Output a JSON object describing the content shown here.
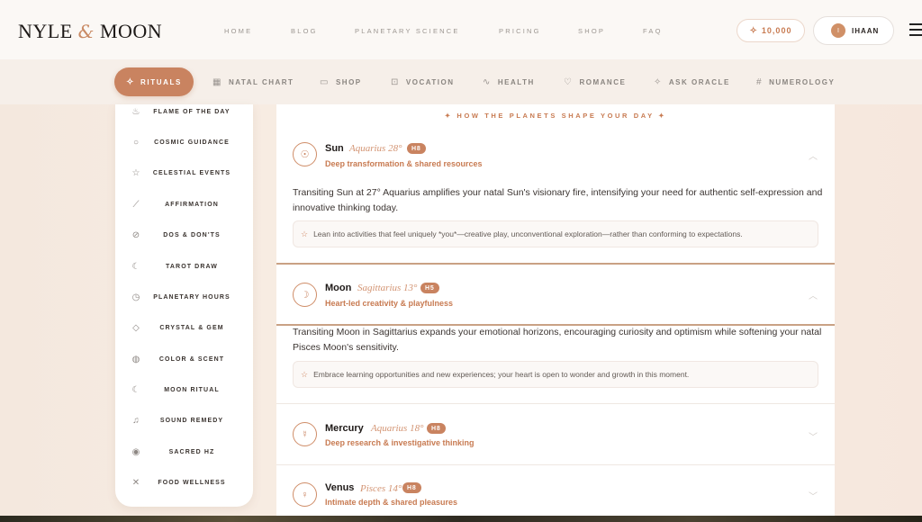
{
  "brand": {
    "name_a": "NYLE",
    "amp": "&",
    "name_b": "MOON"
  },
  "topnav": [
    "HOME",
    "BLOG",
    "PLANETARY SCIENCE",
    "PRICING",
    "SHOP",
    "FAQ"
  ],
  "credits": {
    "icon": "sparkle-icon",
    "value": "10,000"
  },
  "user": {
    "initial": "I",
    "name": "IHAAN"
  },
  "subnav": {
    "active": {
      "icon": "sparkle-icon",
      "label": "RITUALS"
    },
    "items": [
      {
        "icon": "grid-icon",
        "label": "NATAL CHART"
      },
      {
        "icon": "bag-icon",
        "label": "SHOP"
      },
      {
        "icon": "briefcase-icon",
        "label": "VOCATION"
      },
      {
        "icon": "pulse-icon",
        "label": "HEALTH"
      },
      {
        "icon": "heart-icon",
        "label": "ROMANCE"
      },
      {
        "icon": "sparkle-icon",
        "label": "ASK ORACLE"
      },
      {
        "icon": "hash-icon",
        "label": "NUMEROLOGY"
      }
    ]
  },
  "sidebar": {
    "items": [
      {
        "icon": "flame-icon",
        "label": "FLAME OF THE DAY"
      },
      {
        "icon": "chat-icon",
        "label": "COSMIC GUIDANCE"
      },
      {
        "icon": "star-icon",
        "label": "CELESTIAL EVENTS"
      },
      {
        "icon": "feather-icon",
        "label": "AFFIRMATION"
      },
      {
        "icon": "check-circle-icon",
        "label": "DOS & DON'TS"
      },
      {
        "icon": "moon-icon",
        "label": "TAROT DRAW"
      },
      {
        "icon": "clock-icon",
        "label": "PLANETARY HOURS"
      },
      {
        "icon": "gem-icon",
        "label": "CRYSTAL & GEM"
      },
      {
        "icon": "palette-icon",
        "label": "COLOR & SCENT"
      },
      {
        "icon": "moon-star-icon",
        "label": "MOON RITUAL"
      },
      {
        "icon": "music-icon",
        "label": "SOUND REMEDY"
      },
      {
        "icon": "radio-icon",
        "label": "SACRED HZ"
      },
      {
        "icon": "utensils-icon",
        "label": "FOOD WELLNESS"
      }
    ]
  },
  "main": {
    "heading": "✦ HOW THE PLANETS SHAPE YOUR DAY ✦",
    "planets": [
      {
        "symbol": "☉",
        "name": "Sun",
        "sign": "Aquarius 28°",
        "house": "H8",
        "subtitle": "Deep transformation & shared resources",
        "expanded": true,
        "body": "Transiting Sun at 27° Aquarius amplifies your natal Sun's visionary fire, intensifying your need for authentic self-expression and innovative thinking today.",
        "tip": "Lean into activities that feel uniquely *you*—creative play, unconventional exploration—rather than conforming to expectations."
      },
      {
        "symbol": "☽",
        "name": "Moon",
        "sign": "Sagittarius 13°",
        "house": "H5",
        "subtitle": "Heart-led creativity & playfulness",
        "expanded": true,
        "body": "Transiting Moon in Sagittarius expands your emotional horizons, encouraging curiosity and optimism while softening your natal Pisces Moon's sensitivity.",
        "tip": "Embrace learning opportunities and new experiences; your heart is open to wonder and growth in this moment."
      },
      {
        "symbol": "☿",
        "name": "Mercury",
        "sign": "Aquarius 18°",
        "house": "H8",
        "subtitle": "Deep research & investigative thinking",
        "expanded": false
      },
      {
        "symbol": "♀",
        "name": "Venus",
        "sign": "Pisces 14°",
        "house": "H8",
        "subtitle": "Intimate depth & shared pleasures",
        "expanded": false
      }
    ]
  },
  "colors": {
    "accent": "#c98360",
    "background": "#f6ede6"
  }
}
